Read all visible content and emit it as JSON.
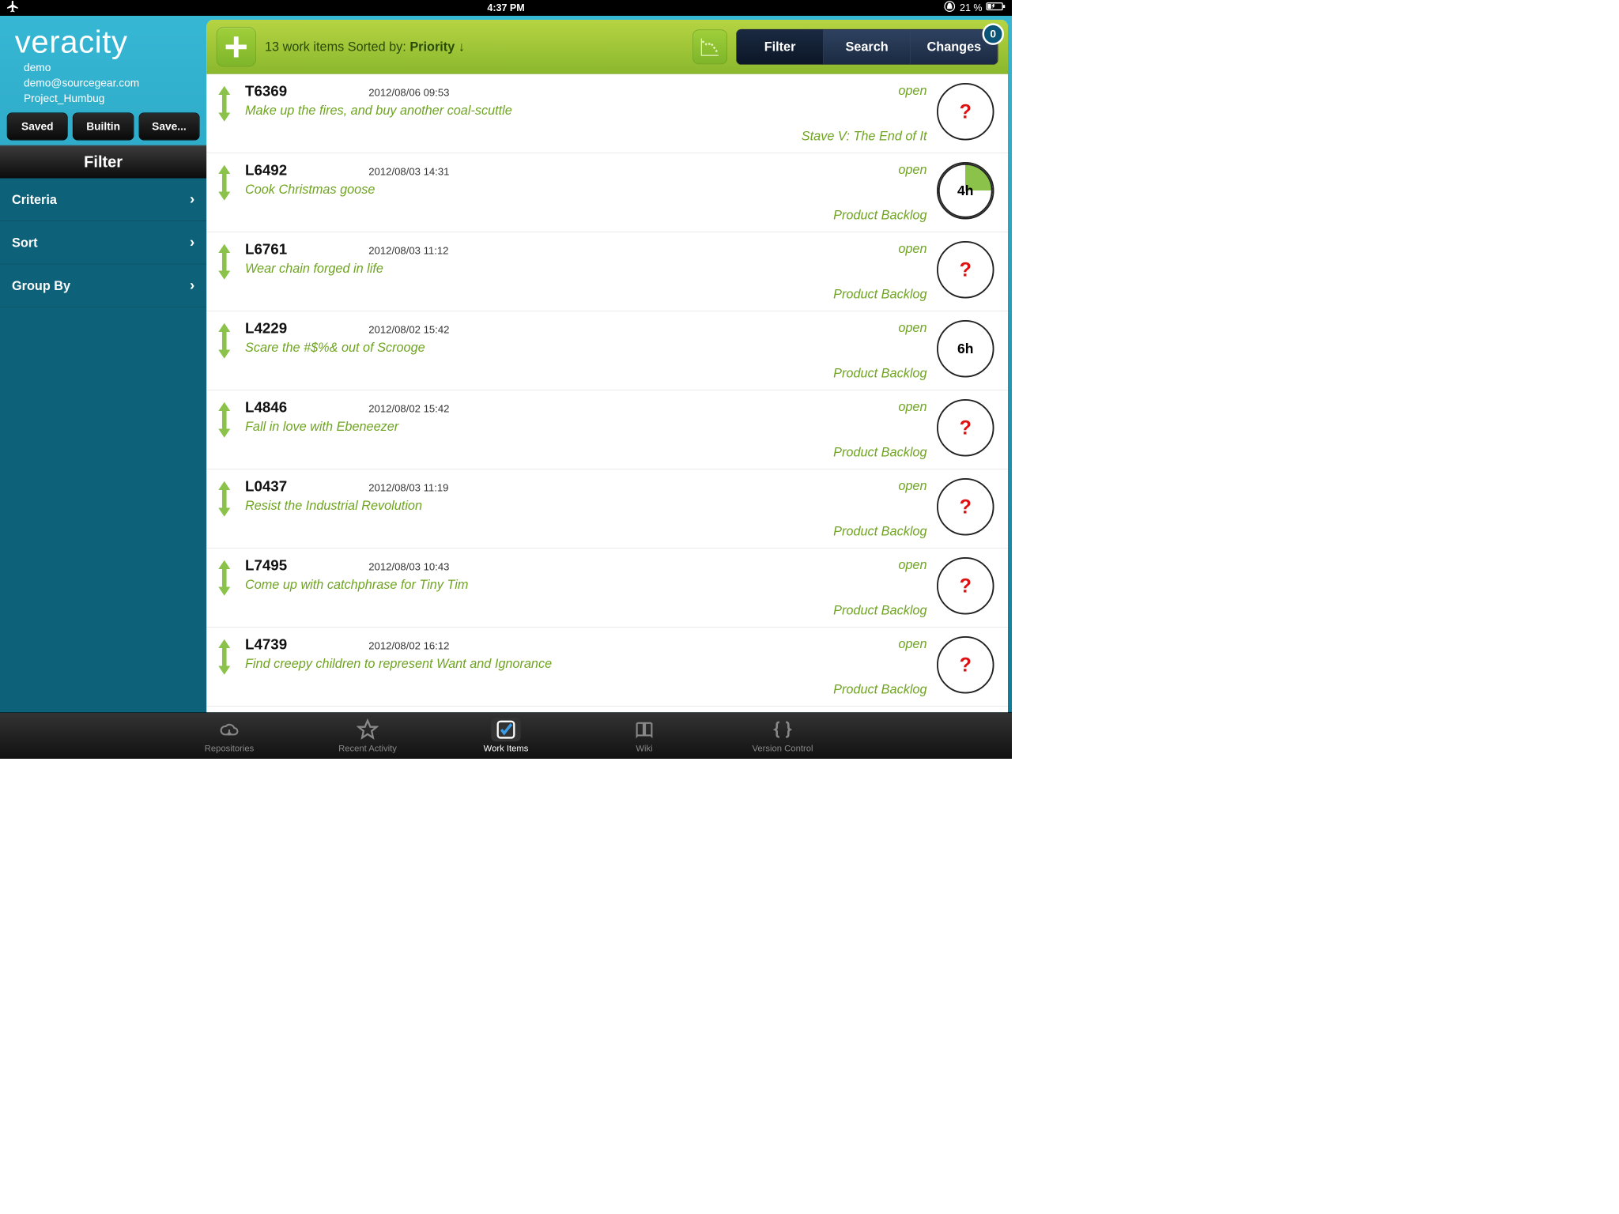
{
  "status": {
    "time": "4:37 PM",
    "battery": "21 %"
  },
  "brand": {
    "logo": "veracity",
    "user": "demo",
    "email": "demo@sourcegear.com",
    "project": "Project_Humbug"
  },
  "sidebarButtons": {
    "saved": "Saved",
    "builtin": "Builtin",
    "save": "Save..."
  },
  "filterHeader": "Filter",
  "filterItems": [
    "Criteria",
    "Sort",
    "Group By"
  ],
  "toolbar": {
    "count_prefix": "13 work items Sorted by: ",
    "sort_field": "Priority",
    "sort_suffix": " ↓",
    "filter": "Filter",
    "search": "Search",
    "changes": "Changes",
    "badge": "0"
  },
  "items": [
    {
      "id": "T6369",
      "date": "2012/08/06 09:53",
      "title": "Make up the fires, and buy another coal-scuttle",
      "status": "open",
      "milestone": "Stave V: The End of It",
      "est": "?"
    },
    {
      "id": "L6492",
      "date": "2012/08/03 14:31",
      "title": "Cook Christmas goose",
      "status": "open",
      "milestone": "Product Backlog",
      "est": "4h",
      "slice": true
    },
    {
      "id": "L6761",
      "date": "2012/08/03 11:12",
      "title": "Wear chain forged in life",
      "status": "open",
      "milestone": "Product Backlog",
      "est": "?"
    },
    {
      "id": "L4229",
      "date": "2012/08/02 15:42",
      "title": "Scare the #$%& out of Scrooge",
      "status": "open",
      "milestone": "Product Backlog",
      "est": "6h"
    },
    {
      "id": "L4846",
      "date": "2012/08/02 15:42",
      "title": "Fall in love with Ebeneezer",
      "status": "open",
      "milestone": "Product Backlog",
      "est": "?"
    },
    {
      "id": "L0437",
      "date": "2012/08/03 11:19",
      "title": "Resist the Industrial Revolution",
      "status": "open",
      "milestone": "Product Backlog",
      "est": "?"
    },
    {
      "id": "L7495",
      "date": "2012/08/03 10:43",
      "title": "Come up with catchphrase for Tiny Tim",
      "status": "open",
      "milestone": "Product Backlog",
      "est": "?"
    },
    {
      "id": "L4739",
      "date": "2012/08/02 16:12",
      "title": "Find creepy children to represent Want and Ignorance",
      "status": "open",
      "milestone": "Product Backlog",
      "est": "?"
    }
  ],
  "tabs": {
    "repos": "Repositories",
    "recent": "Recent Activity",
    "work": "Work Items",
    "wiki": "Wiki",
    "vc": "Version Control"
  }
}
